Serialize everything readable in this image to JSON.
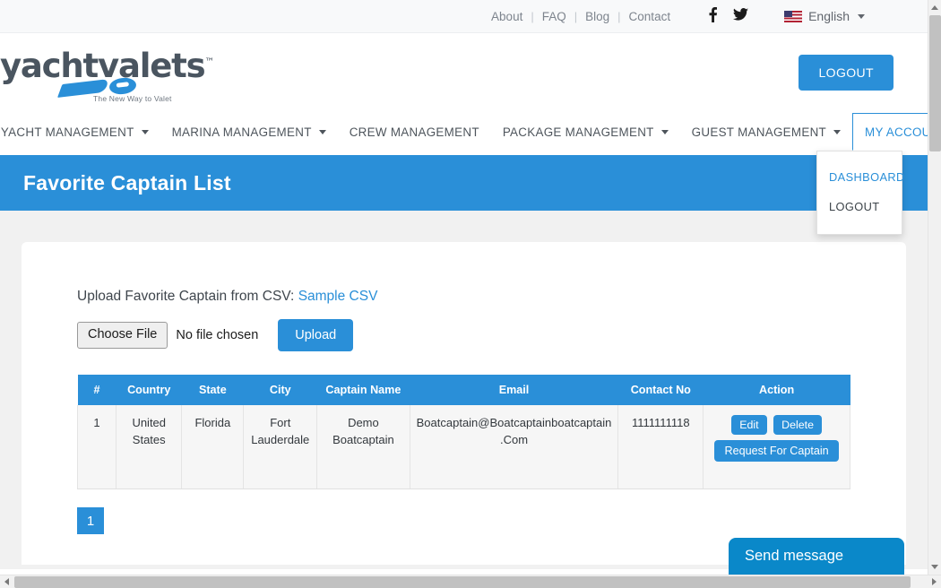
{
  "topbar": {
    "links": [
      {
        "label": "About"
      },
      {
        "label": "FAQ"
      },
      {
        "label": "Blog"
      },
      {
        "label": "Contact"
      }
    ],
    "separator": "|",
    "social": [
      {
        "name": "facebook-icon",
        "glyph": "f"
      },
      {
        "name": "twitter-icon",
        "glyph": "🐦"
      }
    ],
    "language": "English"
  },
  "header": {
    "logo_text": "yachtvalets",
    "logo_tm": "™",
    "logo_tagline": "The New Way to Valet",
    "logout_label": "LOGOUT"
  },
  "nav": {
    "items": [
      {
        "label": "YACHT MANAGEMENT",
        "caret": true,
        "active": false
      },
      {
        "label": "MARINA MANAGEMENT",
        "caret": true,
        "active": false
      },
      {
        "label": "CREW MANAGEMENT",
        "caret": false,
        "active": false
      },
      {
        "label": "PACKAGE MANAGEMENT",
        "caret": true,
        "active": false
      },
      {
        "label": "GUEST MANAGEMENT",
        "caret": true,
        "active": false
      },
      {
        "label": "MY ACCOUNT",
        "caret": true,
        "active": true
      }
    ],
    "dropdown": {
      "items": [
        {
          "label": "DASHBOARD",
          "highlighted": true
        },
        {
          "label": "LOGOUT",
          "highlighted": false
        }
      ]
    }
  },
  "banner": {
    "title": "Favorite Captain List"
  },
  "upload": {
    "label": "Upload Favorite Captain from CSV:",
    "sample_link": "Sample CSV",
    "choose_file_label": "Choose File",
    "no_file_text": "No file chosen",
    "upload_button": "Upload"
  },
  "table": {
    "columns": [
      "#",
      "Country",
      "State",
      "City",
      "Captain Name",
      "Email",
      "Contact No",
      "Action"
    ],
    "rows": [
      {
        "index": "1",
        "country": "United States",
        "state": "Florida",
        "city": "Fort Lauderdale",
        "captain_name": "Demo Boatcaptain",
        "email": "Boatcaptain@Boatcaptainboatcaptain.Com",
        "contact_no": "1111111118",
        "actions": [
          {
            "label": "Edit"
          },
          {
            "label": "Delete"
          },
          {
            "label": "Request For Captain"
          }
        ]
      }
    ]
  },
  "pagination": {
    "pages": [
      "1"
    ],
    "current": "1"
  },
  "chat": {
    "label": "Send message"
  },
  "colors": {
    "brand_blue": "#2a8fd8",
    "chat_blue": "#0a88c9",
    "page_bg": "#f1f1f1",
    "topbar_bg": "#f8f9fa",
    "table_row_bg": "#f6f6f6"
  }
}
